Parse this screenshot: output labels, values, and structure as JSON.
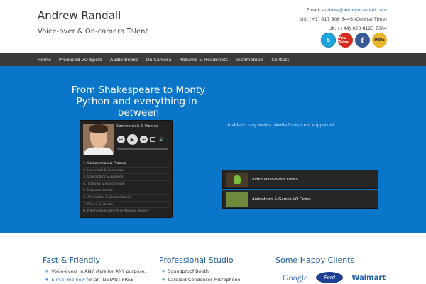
{
  "header": {
    "title": "Andrew Randall",
    "tagline": "Voice-over & On-camera Talent",
    "email_label": "Email:",
    "email": "andrew@andrewrandall.com",
    "us_phone": "US: (+1) 817 806 6446 (Central Time)",
    "uk_phone": "UK: (+44) 020 8123 7364",
    "socials": [
      {
        "name": "skype",
        "glyph": "S"
      },
      {
        "name": "youtube",
        "glyph": "You Tube"
      },
      {
        "name": "facebook",
        "glyph": "f"
      },
      {
        "name": "imdb",
        "glyph": "IMDb"
      }
    ]
  },
  "nav": {
    "items": [
      "Home",
      "Produced VO Spots",
      "Audio Books",
      "On Camera",
      "Resume & Headshots",
      "Testimonials",
      "Contact"
    ]
  },
  "hero": {
    "title": "From Shakespeare to Monty Python and everything in-between",
    "player": {
      "current_track": "Commercials & Promos",
      "tracks": [
        "1. Commercials & Promos",
        "2. Industrial & Corporate",
        "3. Characters & Accents",
        "4. Training & Educational",
        "5. Documentaries",
        "6. Animation & Video Games",
        "7. Phone Systems",
        "8. North American / Mid Atlantic Accent"
      ]
    },
    "media_message": "Unable to play media. Media format not supported.",
    "videos": [
      "Video Voice-overs Demo",
      "Animations & Games VO Demo"
    ]
  },
  "columns": {
    "fast": {
      "title": "Fast & Friendly",
      "item1": "Voice-overs in ANY style for ANY purpose.",
      "item2_link": "E-mail me now",
      "item2_rest": " for an INSTANT FREE"
    },
    "studio": {
      "title": "Professional Studio",
      "items": [
        "Soundproof Booth",
        "Cardioid Condenser Microphone"
      ]
    },
    "clients": {
      "title": "Some Happy Clients",
      "logos": [
        "Google",
        "Ford",
        "Walmart"
      ]
    }
  },
  "colors": {
    "hero_bg": "#0a76c9",
    "nav_bg": "#3a3a3a",
    "heading_blue": "#1c5aa3"
  }
}
